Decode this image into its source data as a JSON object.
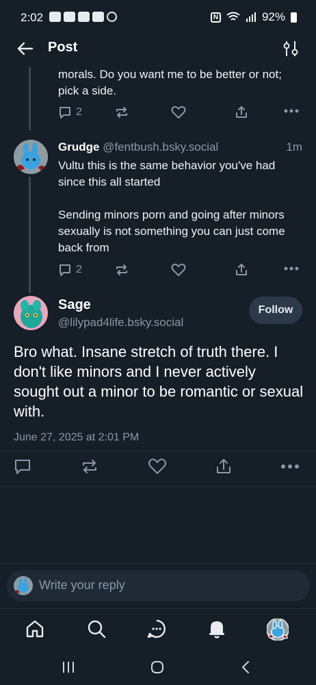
{
  "status_bar": {
    "time": "2:02",
    "battery": "92%",
    "icons": [
      "game-controller-icon",
      "game-controller-icon",
      "youtube-icon",
      "gallery-icon",
      "threads-icon",
      "nfc-icon",
      "wifi-icon",
      "signal-icon",
      "battery-icon"
    ]
  },
  "header": {
    "back_icon": "arrow-left-icon",
    "title": "Post",
    "filter_icon": "sliders-icon"
  },
  "posts": [
    {
      "text": "morals. Do you want me to be better or not; pick a side.",
      "replies": "2"
    },
    {
      "author": "Grudge",
      "handle": "@fentbush.bsky.social",
      "time": "1m",
      "text": "Vultu this is the same behavior you've had since this all started\n\nSending minors porn and going after minors sexually is not something you can just come back from",
      "replies": "2"
    }
  ],
  "main_post": {
    "author": "Sage",
    "handle": "@lilypad4life.bsky.social",
    "follow_label": "Follow",
    "text": "Bro what. Insane stretch of truth there. I don't like minors and I never actively sought out a minor to be romantic or sexual with.",
    "date": "June 27, 2025 at 2:01 PM"
  },
  "reply_box": {
    "placeholder": "Write your reply"
  },
  "bottom_nav": [
    "home-icon",
    "search-icon",
    "chat-icon",
    "bell-icon",
    "profile-avatar"
  ],
  "colors": {
    "background": "#161e27",
    "muted": "#8b98a8",
    "follow_bg": "#2b3949"
  }
}
